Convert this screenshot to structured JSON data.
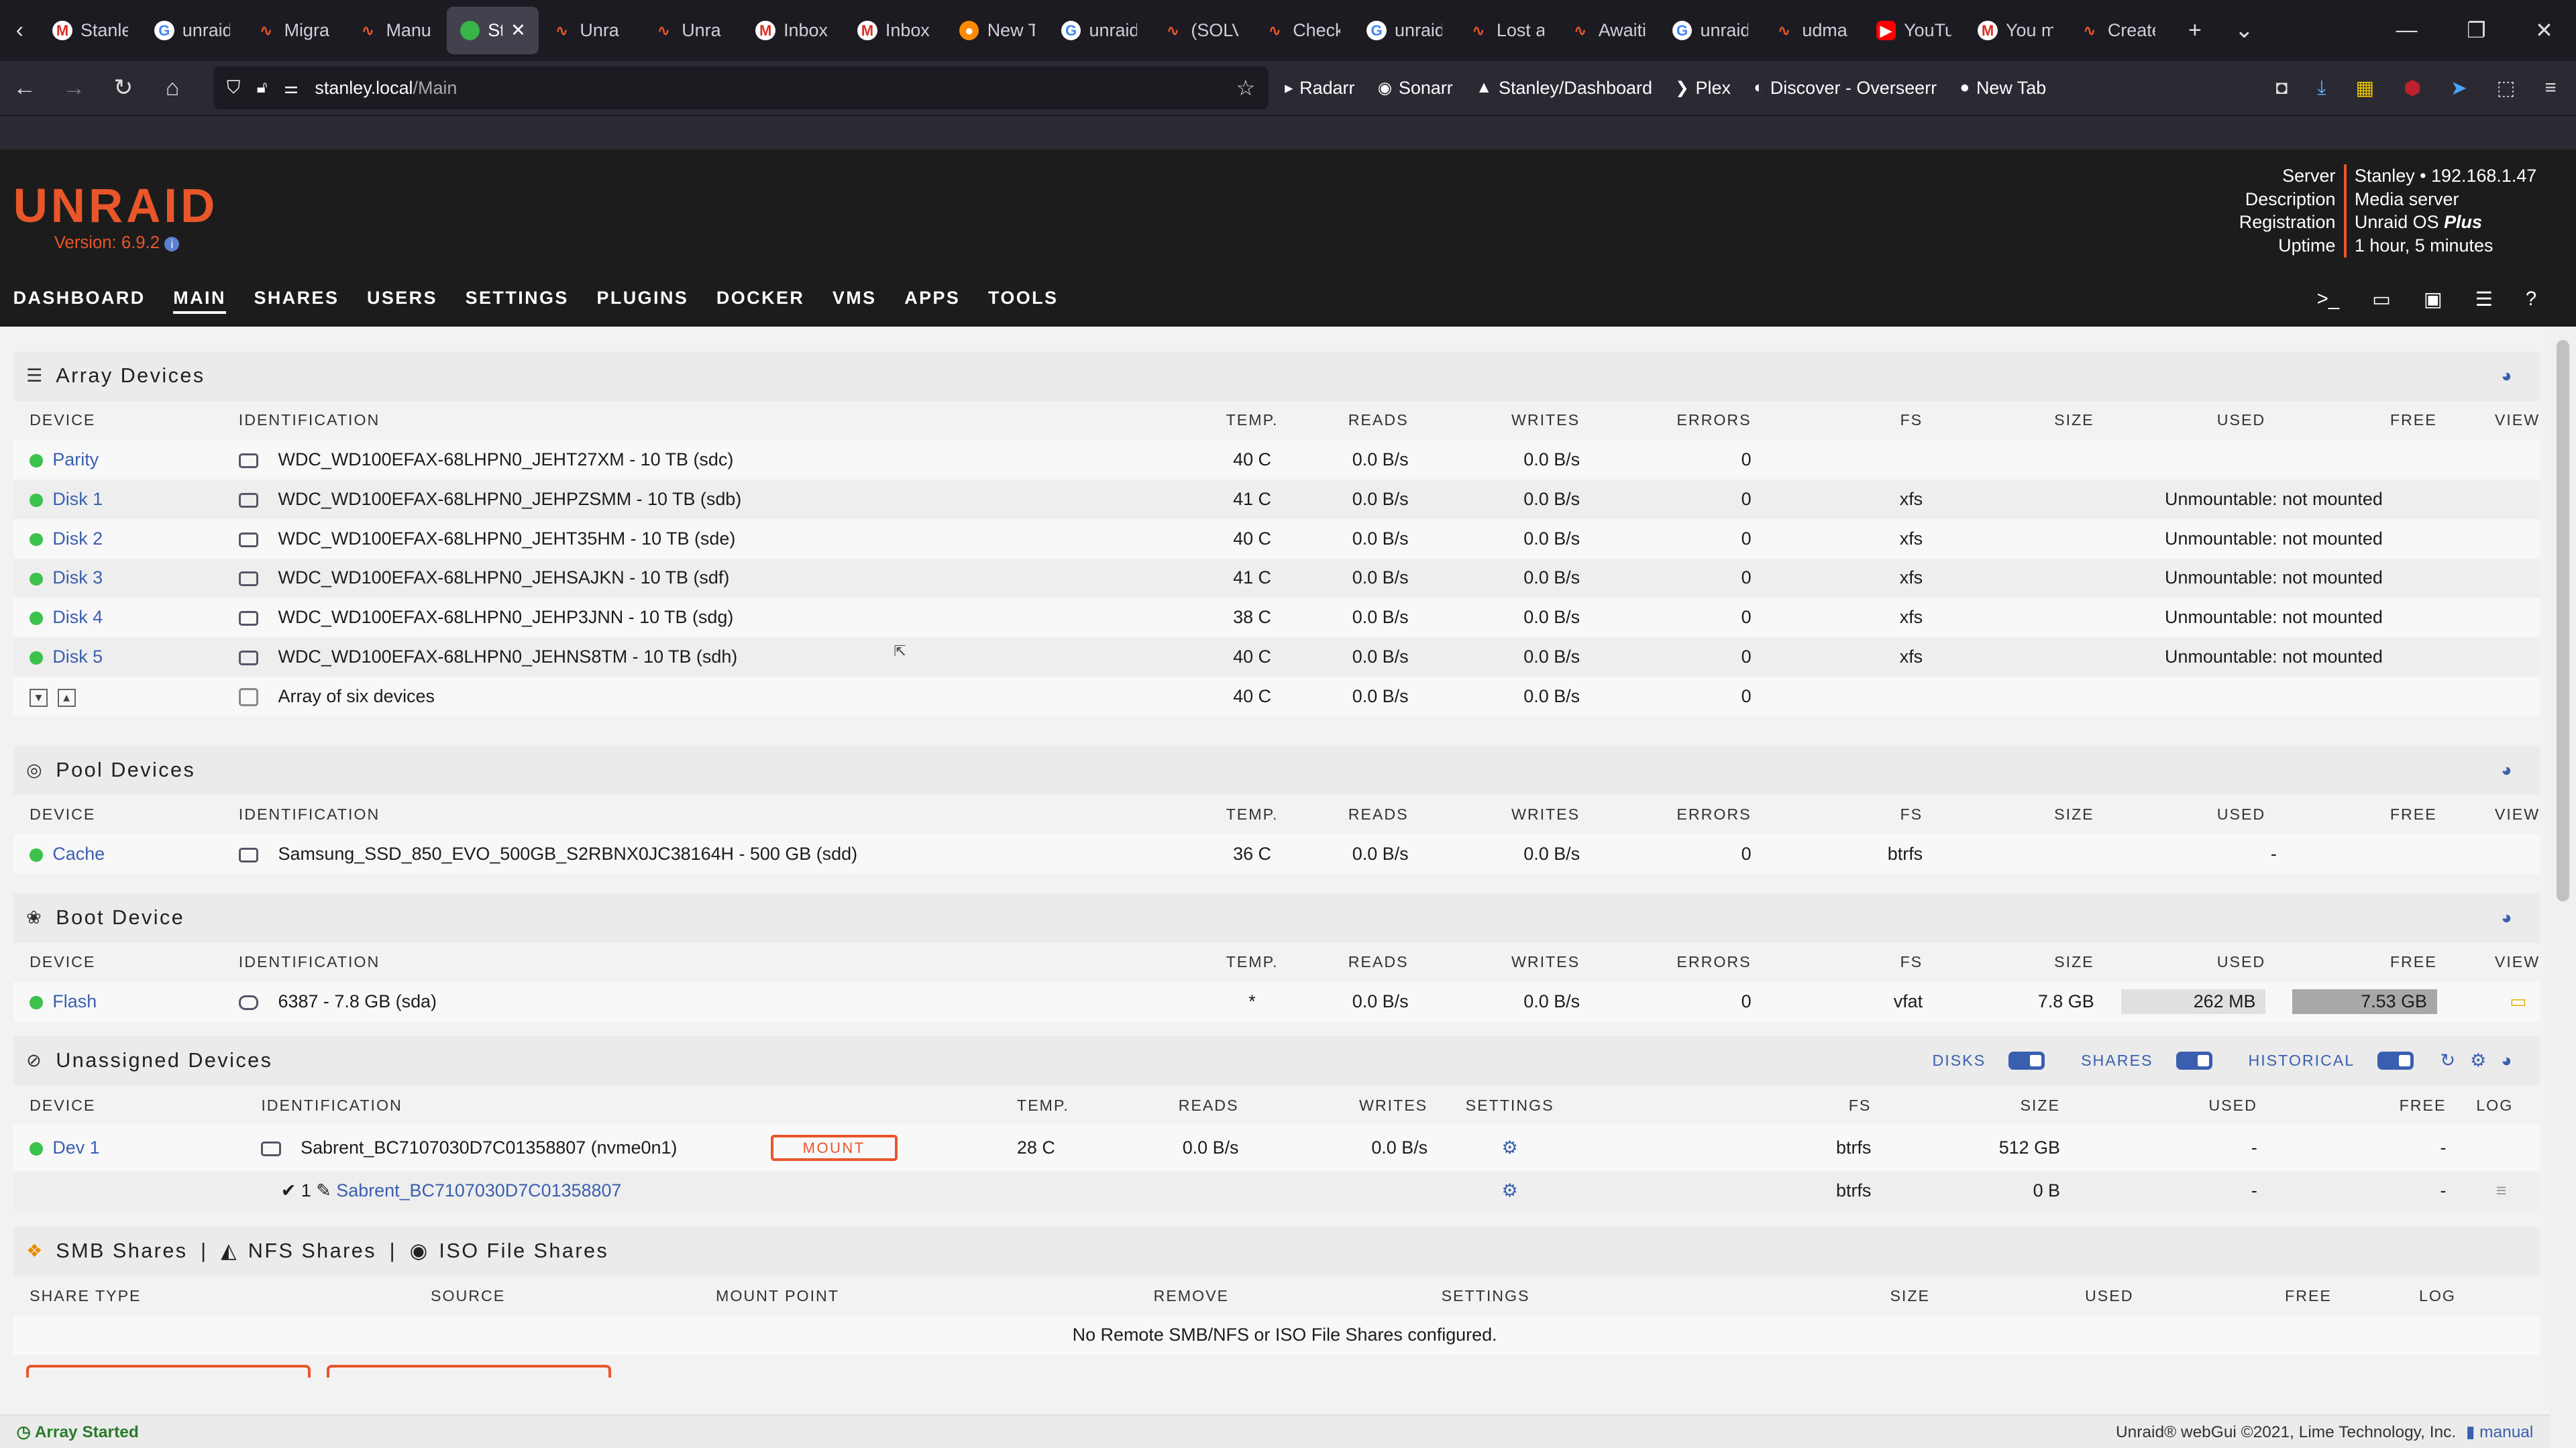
{
  "browser": {
    "tabs": [
      {
        "label": "Stanley/Re",
        "fav": "fav-m",
        "glyph": "M",
        "active": false
      },
      {
        "label": "unraid",
        "fav": "fav-g",
        "glyph": "G",
        "active": false
      },
      {
        "label": "Migra",
        "fav": "fav-u",
        "glyph": "∿",
        "active": false
      },
      {
        "label": "Manu",
        "fav": "fav-u",
        "glyph": "∿",
        "active": false
      },
      {
        "label": "Sta",
        "fav": "fav-act",
        "glyph": "",
        "active": true
      },
      {
        "label": "Unra",
        "fav": "fav-u",
        "glyph": "∿",
        "active": false
      },
      {
        "label": "Unra",
        "fav": "fav-u",
        "glyph": "∿",
        "active": false
      },
      {
        "label": "Inbox",
        "fav": "fav-m",
        "glyph": "M",
        "active": false
      },
      {
        "label": "Inbox",
        "fav": "fav-m",
        "glyph": "M",
        "active": false
      },
      {
        "label": "New T",
        "fav": "fav-f",
        "glyph": "●",
        "active": false
      },
      {
        "label": "unraid",
        "fav": "fav-g",
        "glyph": "G",
        "active": false
      },
      {
        "label": "(SOLV",
        "fav": "fav-u",
        "glyph": "∿",
        "active": false
      },
      {
        "label": "Check",
        "fav": "fav-u",
        "glyph": "∿",
        "active": false
      },
      {
        "label": "unraid",
        "fav": "fav-g",
        "glyph": "G",
        "active": false
      },
      {
        "label": "Lost a",
        "fav": "fav-u",
        "glyph": "∿",
        "active": false
      },
      {
        "label": "Awaiti",
        "fav": "fav-u",
        "glyph": "∿",
        "active": false
      },
      {
        "label": "unraid",
        "fav": "fav-g",
        "glyph": "G",
        "active": false
      },
      {
        "label": "udma",
        "fav": "fav-u",
        "glyph": "∿",
        "active": false
      },
      {
        "label": "YouTu",
        "fav": "fav-y",
        "glyph": "▶",
        "active": false
      },
      {
        "label": "You m",
        "fav": "fav-m",
        "glyph": "M",
        "active": false
      },
      {
        "label": "Create",
        "fav": "fav-u",
        "glyph": "∿",
        "active": false
      }
    ],
    "url_host": "stanley.local",
    "url_path": "/Main",
    "bookmarks": [
      {
        "label": "Radarr",
        "icon": "▸"
      },
      {
        "label": "Sonarr",
        "icon": "◉"
      },
      {
        "label": "Stanley/Dashboard",
        "icon": "▲"
      },
      {
        "label": "Plex",
        "icon": "❯"
      },
      {
        "label": "Discover - Overseerr",
        "icon": "◐"
      },
      {
        "label": "New Tab",
        "icon": "●"
      }
    ]
  },
  "header": {
    "logo": "UNRAID",
    "version": "Version: 6.9.2",
    "server_label": "Server",
    "server_value": "Stanley • 192.168.1.47",
    "description_label": "Description",
    "description_value": "Media server",
    "registration_label": "Registration",
    "registration_value": "Unraid OS ",
    "registration_plus": "Plus",
    "uptime_label": "Uptime",
    "uptime_value": "1 hour, 5 minutes"
  },
  "nav": [
    "DASHBOARD",
    "MAIN",
    "SHARES",
    "USERS",
    "SETTINGS",
    "PLUGINS",
    "DOCKER",
    "VMS",
    "APPS",
    "TOOLS"
  ],
  "columns": [
    "DEVICE",
    "IDENTIFICATION",
    "TEMP.",
    "READS",
    "WRITES",
    "ERRORS",
    "FS",
    "SIZE",
    "USED",
    "FREE",
    "VIEW"
  ],
  "array": {
    "title": "Array Devices",
    "rows": [
      {
        "device": "Parity",
        "id": "WDC_WD100EFAX-68LHPN0_JEHT27XM - 10 TB (sdc)",
        "temp": "40 C",
        "reads": "0.0 B/s",
        "writes": "0.0 B/s",
        "errors": "0",
        "fs": "",
        "status": ""
      },
      {
        "device": "Disk 1",
        "id": "WDC_WD100EFAX-68LHPN0_JEHPZSMM - 10 TB (sdb)",
        "temp": "41 C",
        "reads": "0.0 B/s",
        "writes": "0.0 B/s",
        "errors": "0",
        "fs": "xfs",
        "status": "Unmountable: not mounted"
      },
      {
        "device": "Disk 2",
        "id": "WDC_WD100EFAX-68LHPN0_JEHT35HM - 10 TB (sde)",
        "temp": "40 C",
        "reads": "0.0 B/s",
        "writes": "0.0 B/s",
        "errors": "0",
        "fs": "xfs",
        "status": "Unmountable: not mounted"
      },
      {
        "device": "Disk 3",
        "id": "WDC_WD100EFAX-68LHPN0_JEHSAJKN - 10 TB (sdf)",
        "temp": "41 C",
        "reads": "0.0 B/s",
        "writes": "0.0 B/s",
        "errors": "0",
        "fs": "xfs",
        "status": "Unmountable: not mounted"
      },
      {
        "device": "Disk 4",
        "id": "WDC_WD100EFAX-68LHPN0_JEHP3JNN - 10 TB (sdg)",
        "temp": "38 C",
        "reads": "0.0 B/s",
        "writes": "0.0 B/s",
        "errors": "0",
        "fs": "xfs",
        "status": "Unmountable: not mounted"
      },
      {
        "device": "Disk 5",
        "id": "WDC_WD100EFAX-68LHPN0_JEHNS8TM - 10 TB (sdh)",
        "temp": "40 C",
        "reads": "0.0 B/s",
        "writes": "0.0 B/s",
        "errors": "0",
        "fs": "xfs",
        "status": "Unmountable: not mounted"
      }
    ],
    "summary": {
      "id": "Array of six devices",
      "temp": "40 C",
      "reads": "0.0 B/s",
      "writes": "0.0 B/s",
      "errors": "0"
    }
  },
  "pool": {
    "title": "Pool Devices",
    "rows": [
      {
        "device": "Cache",
        "id": "Samsung_SSD_850_EVO_500GB_S2RBNX0JC38164H - 500 GB (sdd)",
        "temp": "36 C",
        "reads": "0.0 B/s",
        "writes": "0.0 B/s",
        "errors": "0",
        "fs": "btrfs",
        "used": "-"
      }
    ]
  },
  "boot": {
    "title": "Boot Device",
    "row": {
      "device": "Flash",
      "id": "6387 - 7.8 GB (sda)",
      "temp": "*",
      "reads": "0.0 B/s",
      "writes": "0.0 B/s",
      "errors": "0",
      "fs": "vfat",
      "size": "7.8 GB",
      "used": "262 MB",
      "free": "7.53 GB"
    }
  },
  "unassigned": {
    "title": "Unassigned Devices",
    "toggle_disks": "DISKS",
    "toggle_shares": "SHARES",
    "toggle_historical": "HISTORICAL",
    "columns": [
      "DEVICE",
      "IDENTIFICATION",
      "TEMP.",
      "READS",
      "WRITES",
      "SETTINGS",
      "FS",
      "SIZE",
      "USED",
      "FREE",
      "LOG"
    ],
    "row": {
      "device": "Dev 1",
      "id": "Sabrent_BC7107030D7C01358807 (nvme0n1)",
      "mount": "MOUNT",
      "temp": "28 C",
      "reads": "0.0 B/s",
      "writes": "0.0 B/s",
      "fs": "btrfs",
      "size": "512 GB",
      "used": "-",
      "free": "-"
    },
    "partition": {
      "num": "1",
      "name": "Sabrent_BC7107030D7C01358807",
      "fs": "btrfs",
      "size": "0 B",
      "used": "-",
      "free": "-"
    }
  },
  "shares": {
    "title_smb": "SMB Shares",
    "title_nfs": "NFS Shares",
    "title_iso": "ISO File Shares",
    "sep": "|",
    "columns": [
      "SHARE TYPE",
      "SOURCE",
      "MOUNT POINT",
      "REMOVE",
      "SETTINGS",
      "SIZE",
      "USED",
      "FREE",
      "LOG"
    ],
    "empty": "No Remote SMB/NFS or ISO File Shares configured."
  },
  "footer": {
    "status": "Array Started",
    "copyright": "Unraid® webGui ©2021, Lime Technology, Inc.",
    "manual": "manual"
  }
}
